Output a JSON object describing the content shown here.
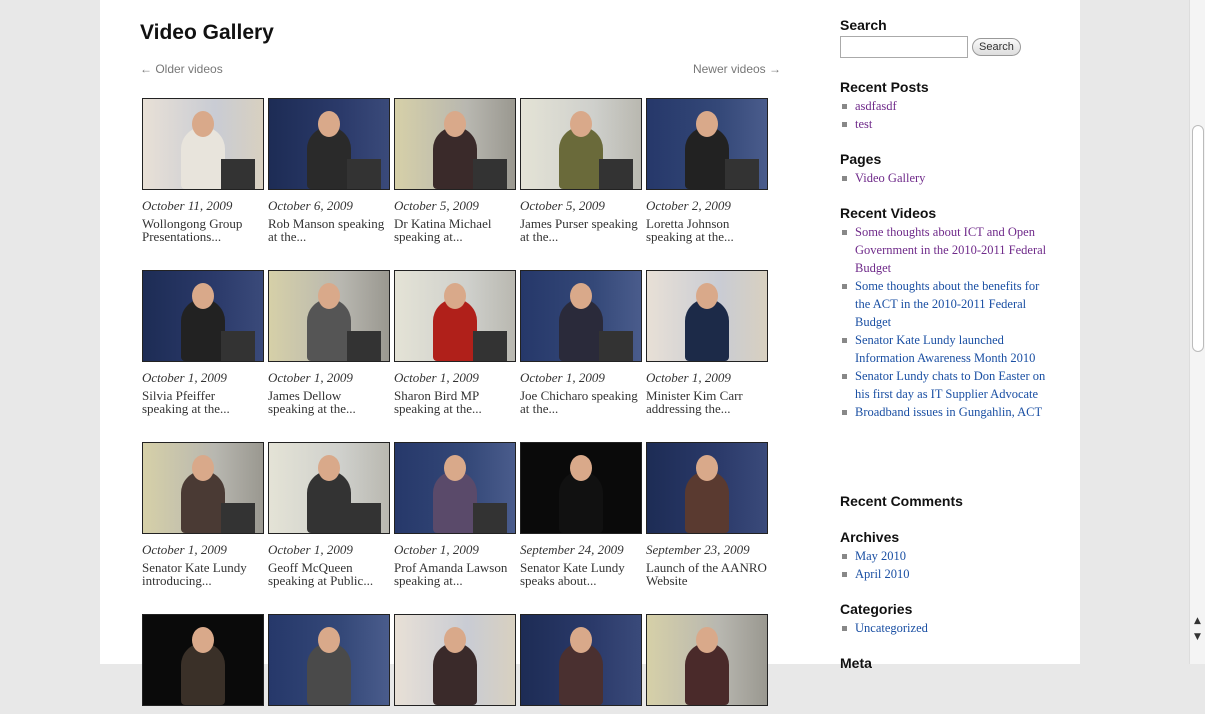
{
  "main": {
    "title": "Video Gallery",
    "older": "← Older videos",
    "newer": "Newer videos →",
    "videos": [
      {
        "date": "October 11, 2009",
        "caption": "Wollongong Group Presentations..."
      },
      {
        "date": "October 6, 2009",
        "caption": "Rob Manson speaking at the..."
      },
      {
        "date": "October 5, 2009",
        "caption": "Dr Katina Michael speaking at..."
      },
      {
        "date": "October 5, 2009",
        "caption": "James Purser speaking at the..."
      },
      {
        "date": "October 2, 2009",
        "caption": "Loretta Johnson speaking at the..."
      },
      {
        "date": "October 1, 2009",
        "caption": "Silvia Pfeiffer speaking at the..."
      },
      {
        "date": "October 1, 2009",
        "caption": "James Dellow speaking at the..."
      },
      {
        "date": "October 1, 2009",
        "caption": "Sharon Bird MP speaking at the..."
      },
      {
        "date": "October 1, 2009",
        "caption": "Joe Chicharo speaking at the..."
      },
      {
        "date": "October 1, 2009",
        "caption": "Minister Kim Carr addressing the..."
      },
      {
        "date": "October 1, 2009",
        "caption": "Senator Kate Lundy introducing..."
      },
      {
        "date": "October 1, 2009",
        "caption": "Geoff McQueen speaking at Public..."
      },
      {
        "date": "October 1, 2009",
        "caption": "Prof Amanda Lawson speaking at..."
      },
      {
        "date": "September 24, 2009",
        "caption": "Senator Kate Lundy speaks about..."
      },
      {
        "date": "September 23, 2009",
        "caption": "Launch of the AANRO Website"
      },
      {
        "date": "",
        "caption": ""
      },
      {
        "date": "",
        "caption": ""
      },
      {
        "date": "",
        "caption": ""
      },
      {
        "date": "",
        "caption": ""
      },
      {
        "date": "",
        "caption": ""
      }
    ]
  },
  "sidebar": {
    "search_heading": "Search",
    "search_value": "",
    "search_button": "Search",
    "recent_posts_heading": "Recent Posts",
    "recent_posts": [
      "asdfasdf",
      "test"
    ],
    "pages_heading": "Pages",
    "pages": [
      "Video Gallery"
    ],
    "recent_videos_heading": "Recent Videos",
    "recent_videos": [
      "Some thoughts about ICT and Open Government in the 2010-2011 Federal Budget",
      "Some thoughts about the benefits for the ACT in the 2010-2011 Federal Budget",
      "Senator Kate Lundy launched Information Awareness Month 2010",
      "Senator Lundy chats to Don Easter on his first day as IT Supplier Advocate",
      "Broadband issues in Gungahlin, ACT"
    ],
    "recent_comments_heading": "Recent Comments",
    "archives_heading": "Archives",
    "archives": [
      "May 2010",
      "April 2010"
    ],
    "categories_heading": "Categories",
    "categories": [
      "Uncategorized"
    ],
    "meta_heading": "Meta"
  },
  "colors": {
    "visited_link": "#6f2a8a",
    "link": "#1a4fa3"
  }
}
